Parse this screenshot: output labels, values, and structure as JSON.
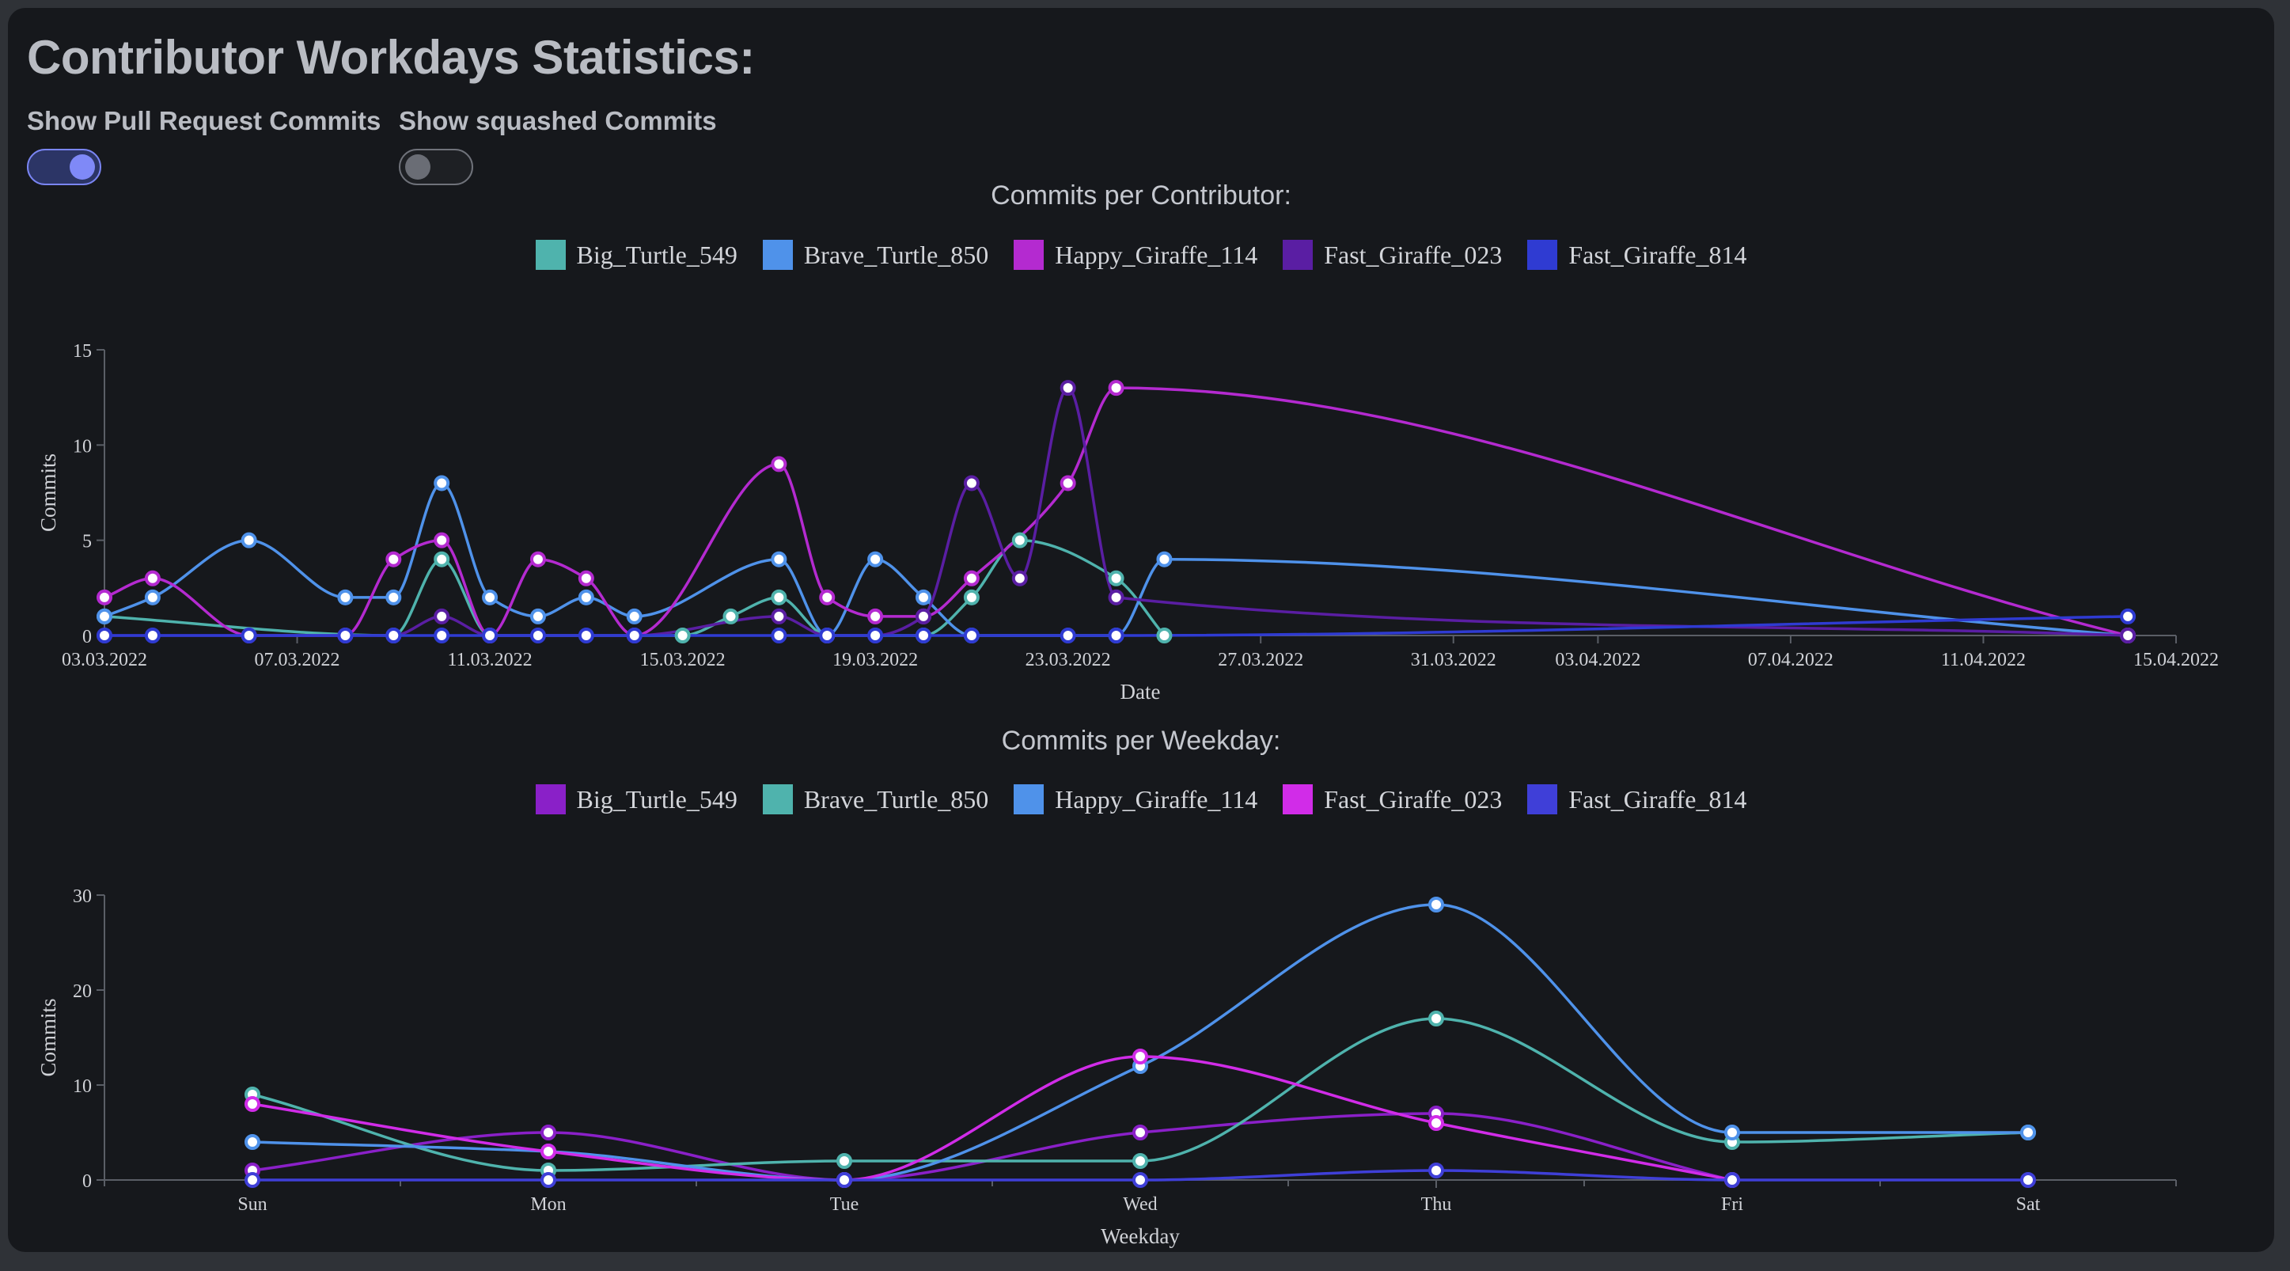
{
  "page": {
    "title": "Contributor Workdays Statistics:",
    "toggles": [
      {
        "label": "Show Pull Request Commits",
        "on": true
      },
      {
        "label": "Show squashed Commits",
        "on": false
      }
    ]
  },
  "chart_data": [
    {
      "type": "line",
      "title": "Commits per Contributor:",
      "xlabel": "Date",
      "ylabel": "Commits",
      "ylim": [
        0,
        15
      ],
      "yticks": [
        0,
        5,
        10,
        15
      ],
      "xlim": [
        "03.03.2022",
        "15.04.2022"
      ],
      "xticks": [
        "03.03.2022",
        "07.03.2022",
        "11.03.2022",
        "15.03.2022",
        "19.03.2022",
        "23.03.2022",
        "27.03.2022",
        "31.03.2022",
        "03.04.2022",
        "07.04.2022",
        "11.04.2022",
        "15.04.2022"
      ],
      "grid": false,
      "legend_position": "top-center",
      "series": [
        {
          "name": "Big_Turtle_549",
          "color": "#4fb3ad",
          "points": [
            [
              "03.03.2022",
              1
            ],
            [
              "09.03.2022",
              0
            ],
            [
              "10.03.2022",
              4
            ],
            [
              "11.03.2022",
              0
            ],
            [
              "15.03.2022",
              0
            ],
            [
              "16.03.2022",
              1
            ],
            [
              "17.03.2022",
              2
            ],
            [
              "18.03.2022",
              0
            ],
            [
              "20.03.2022",
              0
            ],
            [
              "21.03.2022",
              2
            ],
            [
              "22.03.2022",
              5
            ],
            [
              "24.03.2022",
              3
            ],
            [
              "25.03.2022",
              0
            ]
          ]
        },
        {
          "name": "Brave_Turtle_850",
          "color": "#4f92ea",
          "points": [
            [
              "03.03.2022",
              1
            ],
            [
              "04.03.2022",
              2
            ],
            [
              "06.03.2022",
              5
            ],
            [
              "08.03.2022",
              2
            ],
            [
              "09.03.2022",
              2
            ],
            [
              "10.03.2022",
              8
            ],
            [
              "11.03.2022",
              2
            ],
            [
              "12.03.2022",
              1
            ],
            [
              "13.03.2022",
              2
            ],
            [
              "14.03.2022",
              1
            ],
            [
              "17.03.2022",
              4
            ],
            [
              "18.03.2022",
              0
            ],
            [
              "19.03.2022",
              4
            ],
            [
              "20.03.2022",
              2
            ],
            [
              "21.03.2022",
              0
            ],
            [
              "24.03.2022",
              0
            ],
            [
              "25.03.2022",
              4
            ],
            [
              "14.04.2022",
              0
            ]
          ]
        },
        {
          "name": "Happy_Giraffe_114",
          "color": "#b42ad0",
          "points": [
            [
              "03.03.2022",
              2
            ],
            [
              "04.03.2022",
              3
            ],
            [
              "06.03.2022",
              0
            ],
            [
              "08.03.2022",
              0
            ],
            [
              "09.03.2022",
              4
            ],
            [
              "10.03.2022",
              5
            ],
            [
              "11.03.2022",
              0
            ],
            [
              "12.03.2022",
              4
            ],
            [
              "13.03.2022",
              3
            ],
            [
              "14.03.2022",
              0
            ],
            [
              "17.03.2022",
              9
            ],
            [
              "18.03.2022",
              2
            ],
            [
              "19.03.2022",
              1
            ],
            [
              "20.03.2022",
              1
            ],
            [
              "21.03.2022",
              3
            ],
            [
              "23.03.2022",
              8
            ],
            [
              "24.03.2022",
              13
            ],
            [
              "14.04.2022",
              0
            ]
          ]
        },
        {
          "name": "Fast_Giraffe_023",
          "color": "#5a1ea3",
          "points": [
            [
              "03.03.2022",
              0
            ],
            [
              "09.03.2022",
              0
            ],
            [
              "10.03.2022",
              1
            ],
            [
              "11.03.2022",
              0
            ],
            [
              "14.03.2022",
              0
            ],
            [
              "17.03.2022",
              1
            ],
            [
              "18.03.2022",
              0
            ],
            [
              "19.03.2022",
              0
            ],
            [
              "20.03.2022",
              1
            ],
            [
              "21.03.2022",
              8
            ],
            [
              "22.03.2022",
              3
            ],
            [
              "23.03.2022",
              13
            ],
            [
              "24.03.2022",
              2
            ],
            [
              "14.04.2022",
              0
            ]
          ]
        },
        {
          "name": "Fast_Giraffe_814",
          "color": "#2f3bd2",
          "points": [
            [
              "03.03.2022",
              0
            ],
            [
              "04.03.2022",
              0
            ],
            [
              "06.03.2022",
              0
            ],
            [
              "08.03.2022",
              0
            ],
            [
              "09.03.2022",
              0
            ],
            [
              "10.03.2022",
              0
            ],
            [
              "11.03.2022",
              0
            ],
            [
              "12.03.2022",
              0
            ],
            [
              "13.03.2022",
              0
            ],
            [
              "14.03.2022",
              0
            ],
            [
              "17.03.2022",
              0
            ],
            [
              "18.03.2022",
              0
            ],
            [
              "19.03.2022",
              0
            ],
            [
              "20.03.2022",
              0
            ],
            [
              "21.03.2022",
              0
            ],
            [
              "23.03.2022",
              0
            ],
            [
              "24.03.2022",
              0
            ],
            [
              "14.04.2022",
              1
            ]
          ]
        }
      ]
    },
    {
      "type": "line",
      "title": "Commits per Weekday:",
      "xlabel": "Weekday",
      "ylabel": "Commits",
      "ylim": [
        0,
        30
      ],
      "yticks": [
        0,
        10,
        20,
        30
      ],
      "categories": [
        "Sun",
        "Mon",
        "Tue",
        "Wed",
        "Thu",
        "Fri",
        "Sat"
      ],
      "grid": false,
      "legend_position": "top-center",
      "series": [
        {
          "name": "Big_Turtle_549",
          "color": "#8a20c8",
          "values": [
            1,
            5,
            0,
            5,
            7,
            0,
            null
          ]
        },
        {
          "name": "Brave_Turtle_850",
          "color": "#4fb3ad",
          "values": [
            9,
            1,
            2,
            2,
            17,
            4,
            5
          ]
        },
        {
          "name": "Happy_Giraffe_114",
          "color": "#4f92ea",
          "values": [
            4,
            3,
            0,
            12,
            29,
            5,
            5
          ]
        },
        {
          "name": "Fast_Giraffe_023",
          "color": "#d12ce8",
          "values": [
            8,
            3,
            0,
            13,
            6,
            0,
            null
          ]
        },
        {
          "name": "Fast_Giraffe_814",
          "color": "#3f3fd8",
          "values": [
            0,
            0,
            0,
            0,
            1,
            0,
            0
          ]
        }
      ]
    }
  ]
}
